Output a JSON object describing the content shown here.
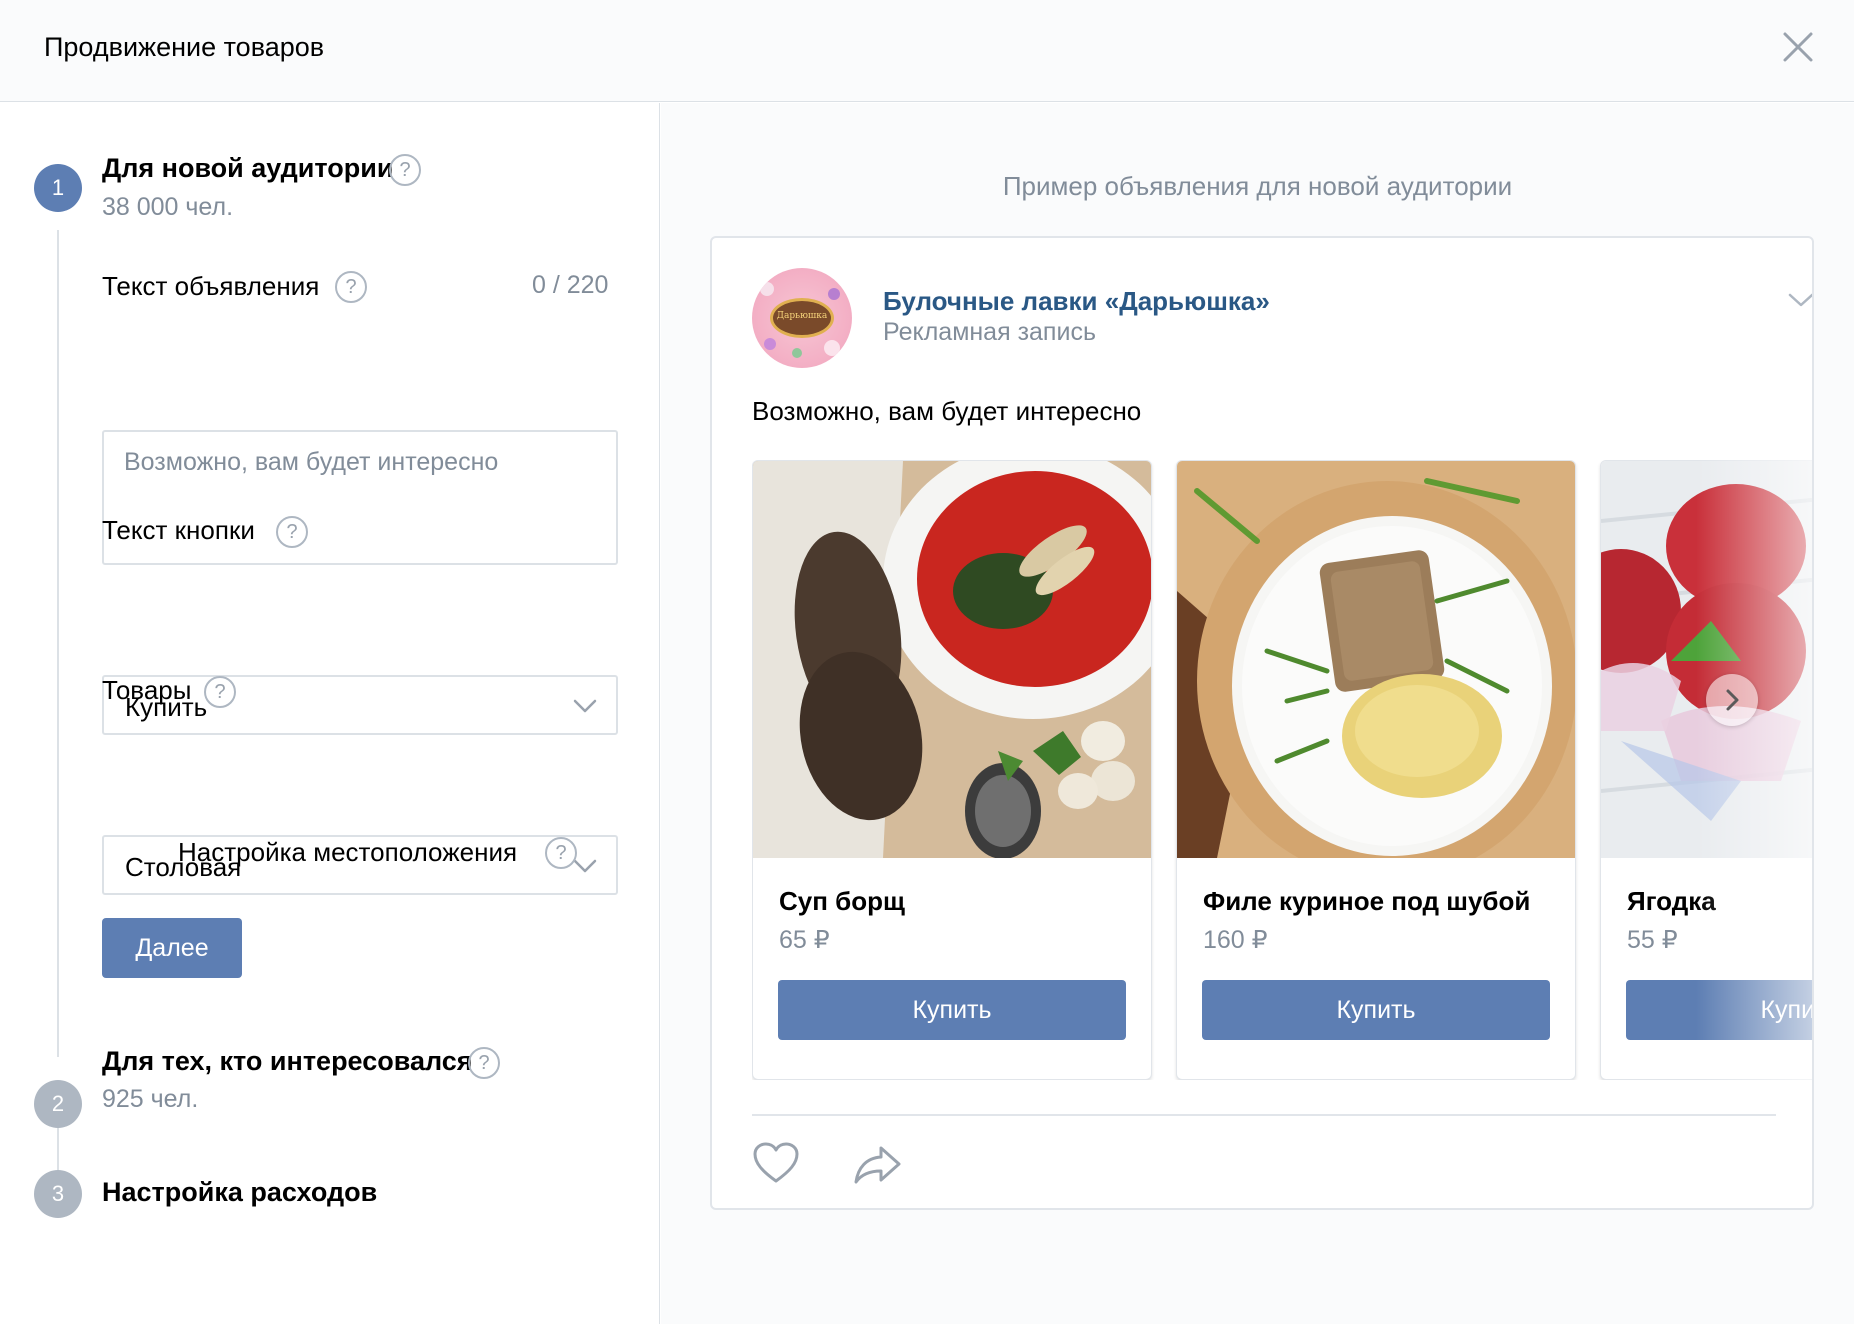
{
  "window": {
    "title": "Продвижение товаров"
  },
  "steps": [
    {
      "number": "1",
      "title": "Для новой аудитории",
      "subtitle": "38 000 чел."
    },
    {
      "number": "2",
      "title": "Для тех, кто интересовался",
      "subtitle": "925 чел."
    },
    {
      "number": "3",
      "title": "Настройка расходов"
    }
  ],
  "form": {
    "ad_text_label": "Текст объявления",
    "ad_text_counter": "0 / 220",
    "ad_text_placeholder": "Возможно, вам будет интересно",
    "ad_text_value": "",
    "button_text_label": "Текст кнопки",
    "button_text_value": "Купить",
    "products_label": "Товары",
    "products_value": "Столовая",
    "location_toggle_label": "Настройка местоположения",
    "location_toggle_on": false,
    "next_button": "Далее"
  },
  "preview": {
    "caption": "Пример объявления для новой аудитории",
    "page_name": "Булочные лавки «Дарьюшка»",
    "ad_label": "Рекламная запись",
    "logo_text": "Дарьюшка",
    "post_text": "Возможно, вам будет интересно",
    "products": [
      {
        "name": "Суп борщ",
        "price": "65 ₽",
        "button": "Купить"
      },
      {
        "name": "Филе куриное под шубой",
        "price": "160 ₽",
        "button": "Купить"
      },
      {
        "name": "Ягодка",
        "price": "55 ₽",
        "button": "Купить"
      }
    ]
  },
  "colors": {
    "accent": "#5d7eb3",
    "link": "#2a5885",
    "muted": "#818c99",
    "border": "#dce1e6"
  },
  "icons": [
    "close-icon",
    "help-icon",
    "chevron-down-icon",
    "chevron-right-icon",
    "heart-icon",
    "share-icon"
  ]
}
